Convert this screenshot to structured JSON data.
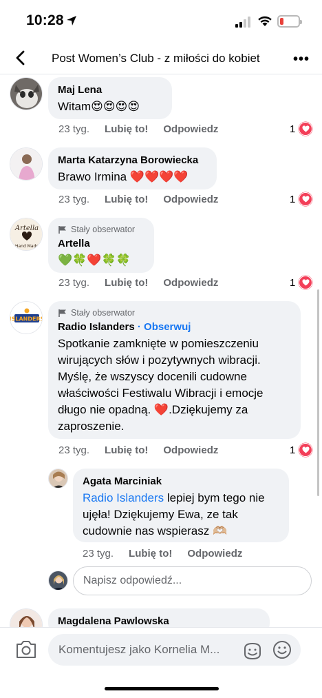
{
  "status": {
    "time": "10:28"
  },
  "header": {
    "title": "Post Women’s Club - z miłości do kobiet"
  },
  "labels": {
    "time": "23 tyg.",
    "like": "Lubię to!",
    "reply": "Odpowiedz",
    "follower_badge": "Stały obserwator",
    "follow": "Obserwuj"
  },
  "comments": [
    {
      "author": "Maj Lena",
      "text": "Witam😍😍😍😍",
      "reactions": "1"
    },
    {
      "author": "Marta Katarzyna Borowiecka",
      "text": "Brawo Irmina ❤️❤️❤️❤️",
      "reactions": "1"
    },
    {
      "author": "Artella",
      "text": "💚🍀❤️🍀🍀",
      "reactions": "1"
    },
    {
      "author": "Radio Islanders",
      "text": "Spotkanie zamknięte w pomieszczeniu wirujących słów i pozytywnych wibracji. Myślę, że wszyscy docenili cudowne właściwości Festiwalu Wibracji  i emocje długo nie opadną. ❤️.Dziękujemy za zaproszenie.",
      "reactions": "1"
    }
  ],
  "reply": {
    "author": "Agata Marciniak",
    "mention": "Radio Islanders",
    "text": " lepiej bym tego nie ujęła! Dziękujemy Ewa, ze tak cudownie nas wspierasz 🫶🏼"
  },
  "reply_input": {
    "placeholder": "Napisz odpowiedź..."
  },
  "next_comment": {
    "author": "Magdalena Pawlowska"
  },
  "composer": {
    "placeholder": "Komentujesz jako Kornelia M..."
  },
  "colors": {
    "accent": "#1877f2",
    "heart": "#f33e58",
    "bubble": "#f0f2f5",
    "meta": "#65676b"
  },
  "icons": [
    "location-arrow-icon",
    "signal-icon",
    "wifi-icon",
    "battery-icon",
    "back-chevron-icon",
    "more-icon",
    "flag-icon",
    "heart-icon",
    "camera-icon",
    "sticker-icon",
    "emoji-icon"
  ]
}
